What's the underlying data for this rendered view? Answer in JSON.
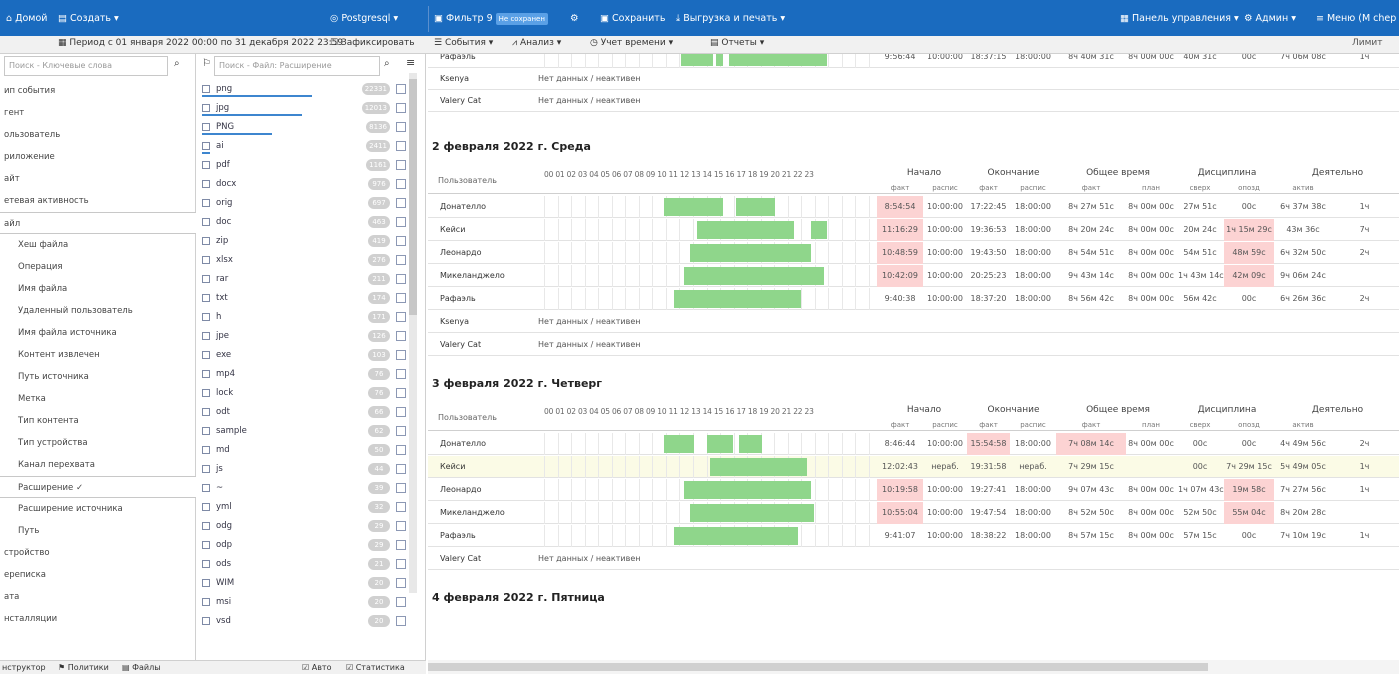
{
  "topbar": {
    "home": "Домой",
    "create": "Создать",
    "db": "Postgresql",
    "filter": "Фильтр 9",
    "not_saved": "Не сохранен",
    "save": "Сохранить",
    "export": "Выгрузка и печать",
    "dashboard": "Панель управления",
    "admin": "Админ",
    "menu": "Меню (M chep"
  },
  "toolbar": {
    "period": "Период с 01 января 2022 00:00 по 31 декабря 2022 23:59",
    "fix": "Зафиксировать",
    "events": "События",
    "analysis": "Анализ",
    "time": "Учет времени",
    "reports": "Отчеты",
    "limit": "Лимит"
  },
  "left": {
    "search": "Поиск - Ключевые слова",
    "items": [
      {
        "label": "ип события",
        "sub": false,
        "sel": false
      },
      {
        "label": "гент",
        "sub": false,
        "sel": false
      },
      {
        "label": "ользователь",
        "sub": false,
        "sel": false
      },
      {
        "label": "риложение",
        "sub": false,
        "sel": false
      },
      {
        "label": "айт",
        "sub": false,
        "sel": false
      },
      {
        "label": "етевая активность",
        "sub": false,
        "sel": false
      },
      {
        "label": "айл",
        "sub": false,
        "sel": true
      },
      {
        "label": "Хеш файла",
        "sub": true,
        "sel": false
      },
      {
        "label": "Операция",
        "sub": true,
        "sel": false
      },
      {
        "label": "Имя файла",
        "sub": true,
        "sel": false
      },
      {
        "label": "Удаленный пользователь",
        "sub": true,
        "sel": false
      },
      {
        "label": "Имя файла источника",
        "sub": true,
        "sel": false
      },
      {
        "label": "Контент извлечен",
        "sub": true,
        "sel": false
      },
      {
        "label": "Путь источника",
        "sub": true,
        "sel": false
      },
      {
        "label": "Метка",
        "sub": true,
        "sel": false
      },
      {
        "label": "Тип контента",
        "sub": true,
        "sel": false
      },
      {
        "label": "Тип устройства",
        "sub": true,
        "sel": false
      },
      {
        "label": "Канал перехвата",
        "sub": true,
        "sel": false
      },
      {
        "label": "Расширение ✓",
        "sub": true,
        "sel": true
      },
      {
        "label": "Расширение источника",
        "sub": true,
        "sel": false
      },
      {
        "label": "Путь",
        "sub": true,
        "sel": false
      },
      {
        "label": "стройство",
        "sub": false,
        "sel": false
      },
      {
        "label": "ереписка",
        "sub": false,
        "sel": false
      },
      {
        "label": "ата",
        "sub": false,
        "sel": false
      },
      {
        "label": "нсталляции",
        "sub": false,
        "sel": false
      }
    ]
  },
  "mid": {
    "search": "Поиск - Файл: Расширение",
    "exts": [
      {
        "name": "png",
        "count": "22331",
        "bar": 0.55
      },
      {
        "name": "jpg",
        "count": "12013",
        "bar": 0.5
      },
      {
        "name": "PNG",
        "count": "8136",
        "bar": 0.35
      },
      {
        "name": "ai",
        "count": "2411",
        "bar": 0.04
      },
      {
        "name": "pdf",
        "count": "1161",
        "bar": 0
      },
      {
        "name": "docx",
        "count": "976",
        "bar": 0
      },
      {
        "name": "orig",
        "count": "697",
        "bar": 0
      },
      {
        "name": "doc",
        "count": "463",
        "bar": 0
      },
      {
        "name": "zip",
        "count": "419",
        "bar": 0
      },
      {
        "name": "xlsx",
        "count": "276",
        "bar": 0
      },
      {
        "name": "rar",
        "count": "211",
        "bar": 0
      },
      {
        "name": "txt",
        "count": "174",
        "bar": 0
      },
      {
        "name": "h",
        "count": "171",
        "bar": 0
      },
      {
        "name": "jpe",
        "count": "126",
        "bar": 0
      },
      {
        "name": "exe",
        "count": "103",
        "bar": 0
      },
      {
        "name": "mp4",
        "count": "76",
        "bar": 0
      },
      {
        "name": "lock",
        "count": "76",
        "bar": 0
      },
      {
        "name": "odt",
        "count": "66",
        "bar": 0
      },
      {
        "name": "sample",
        "count": "62",
        "bar": 0
      },
      {
        "name": "md",
        "count": "50",
        "bar": 0
      },
      {
        "name": "js",
        "count": "44",
        "bar": 0
      },
      {
        "name": "~",
        "count": "39",
        "bar": 0
      },
      {
        "name": "yml",
        "count": "32",
        "bar": 0
      },
      {
        "name": "odg",
        "count": "29",
        "bar": 0
      },
      {
        "name": "odp",
        "count": "29",
        "bar": 0
      },
      {
        "name": "ods",
        "count": "21",
        "bar": 0
      },
      {
        "name": "WIM",
        "count": "20",
        "bar": 0
      },
      {
        "name": "msi",
        "count": "20",
        "bar": 0
      },
      {
        "name": "vsd",
        "count": "20",
        "bar": 0
      }
    ]
  },
  "status": {
    "constructor": "нструктор",
    "policies": "Политики",
    "files": "Файлы",
    "auto": "Авто",
    "stats": "Статистика"
  },
  "hdr": {
    "users": "Пользователь",
    "hours": "00 01 02 03 04 05 06 07 08 09 10 11 12 13 14 15 16 17 18 19 20 21 22 23",
    "start": "Начало",
    "end": "Окончание",
    "total": "Общее время",
    "disc": "Дисциплина",
    "activity": "Деятельно",
    "fact": "факт",
    "sched": "распис",
    "actual": "факт",
    "plan": "план",
    "over": "сверх",
    "late": "опозд",
    "active": "актив"
  },
  "nodata": "Нет данных / неактивен",
  "top_rows": [
    {
      "user": "Рафаэль",
      "v": [
        "9:56:44",
        "10:00:00",
        "18:37:15",
        "18:00:00",
        "8ч 40м 31с",
        "8ч 00м 00с",
        "40м 31с",
        "00с",
        "7ч 06м 08с",
        "1ч"
      ],
      "tl": [
        [
          0.42,
          0.1
        ],
        [
          0.53,
          0.02
        ],
        [
          0.57,
          0.3
        ]
      ]
    },
    {
      "user": "Ksenya",
      "nd": true
    },
    {
      "user": "Valery Cat",
      "nd": true
    }
  ],
  "days": [
    {
      "title": "2 февраля 2022 г. Среда",
      "rows": [
        {
          "user": "Донателло",
          "v": [
            "8:54:54",
            "10:00:00",
            "17:22:45",
            "18:00:00",
            "8ч 27м 51с",
            "8ч 00м 00с",
            "27м 51с",
            "00с",
            "6ч 37м 38с",
            "1ч"
          ],
          "red": [
            0,
            -1,
            -1,
            -1,
            -1,
            -1,
            -1,
            -1
          ],
          "tl": [
            [
              0.37,
              0.18
            ],
            [
              0.59,
              0.12
            ]
          ]
        },
        {
          "user": "Кейси",
          "v": [
            "11:16:29",
            "10:00:00",
            "19:36:53",
            "18:00:00",
            "8ч 20м 24с",
            "8ч 00м 00с",
            "20м 24с",
            "1ч 15м 29с",
            "43м 36с",
            "7ч"
          ],
          "red": [
            0,
            -1,
            -1,
            -1,
            -1,
            -1,
            -1,
            7
          ],
          "tl": [
            [
              0.47,
              0.3
            ],
            [
              0.82,
              0.05
            ]
          ]
        },
        {
          "user": "Леонардо",
          "v": [
            "10:48:59",
            "10:00:00",
            "19:43:50",
            "18:00:00",
            "8ч 54м 51с",
            "8ч 00м 00с",
            "54м 51с",
            "48м 59с",
            "6ч 32м 50с",
            "2ч"
          ],
          "red": [
            0,
            -1,
            -1,
            -1,
            -1,
            -1,
            -1,
            7
          ],
          "tl": [
            [
              0.45,
              0.37
            ]
          ]
        },
        {
          "user": "Микеланджело",
          "v": [
            "10:42:09",
            "10:00:00",
            "20:25:23",
            "18:00:00",
            "9ч 43м 14с",
            "8ч 00м 00с",
            "1ч 43м 14с",
            "42м 09с",
            "9ч 06м 24с",
            ""
          ],
          "red": [
            0,
            -1,
            -1,
            -1,
            -1,
            -1,
            -1,
            7
          ],
          "tl": [
            [
              0.43,
              0.43
            ]
          ]
        },
        {
          "user": "Рафаэль",
          "v": [
            "9:40:38",
            "10:00:00",
            "18:37:20",
            "18:00:00",
            "8ч 56м 42с",
            "8ч 00м 00с",
            "56м 42с",
            "00с",
            "6ч 26м 36с",
            "2ч"
          ],
          "red": [
            -1,
            -1,
            -1,
            -1,
            -1,
            -1,
            -1,
            -1
          ],
          "tl": [
            [
              0.4,
              0.39
            ]
          ]
        },
        {
          "user": "Ksenya",
          "nd": true
        },
        {
          "user": "Valery Cat",
          "nd": true
        }
      ]
    },
    {
      "title": "3 февраля 2022 г. Четверг",
      "rows": [
        {
          "user": "Донателло",
          "v": [
            "8:46:44",
            "10:00:00",
            "15:54:58",
            "18:00:00",
            "7ч 08м 14с",
            "8ч 00м 00с",
            "00с",
            "00с",
            "4ч 49м 56с",
            "2ч"
          ],
          "red": [
            -1,
            -1,
            2,
            -1,
            4,
            -1,
            -1,
            -1
          ],
          "tl": [
            [
              0.37,
              0.09
            ],
            [
              0.5,
              0.08
            ],
            [
              0.6,
              0.07
            ]
          ]
        },
        {
          "user": "Кейси",
          "v": [
            "12:02:43",
            "нераб.",
            "19:31:58",
            "нераб.",
            "7ч 29м 15с",
            "",
            "00с",
            "7ч 29м 15с",
            "5ч 49м 05с",
            "1ч"
          ],
          "yel": true,
          "tl": [
            [
              0.51,
              0.3
            ]
          ]
        },
        {
          "user": "Леонардо",
          "v": [
            "10:19:58",
            "10:00:00",
            "19:27:41",
            "18:00:00",
            "9ч 07м 43с",
            "8ч 00м 00с",
            "1ч 07м 43с",
            "19м 58с",
            "7ч 27м 56с",
            "1ч"
          ],
          "red": [
            0,
            -1,
            -1,
            -1,
            -1,
            -1,
            -1,
            7
          ],
          "tl": [
            [
              0.43,
              0.39
            ]
          ]
        },
        {
          "user": "Микеланджело",
          "v": [
            "10:55:04",
            "10:00:00",
            "19:47:54",
            "18:00:00",
            "8ч 52м 50с",
            "8ч 00м 00с",
            "52м 50с",
            "55м 04с",
            "8ч 20м 28с",
            ""
          ],
          "red": [
            0,
            -1,
            -1,
            -1,
            -1,
            -1,
            -1,
            7
          ],
          "tl": [
            [
              0.45,
              0.38
            ]
          ]
        },
        {
          "user": "Рафаэль",
          "v": [
            "9:41:07",
            "10:00:00",
            "18:38:22",
            "18:00:00",
            "8ч 57м 15с",
            "8ч 00м 00с",
            "57м 15с",
            "00с",
            "7ч 10м 19с",
            "1ч"
          ],
          "red": [
            -1,
            -1,
            -1,
            -1,
            -1,
            -1,
            -1,
            -1
          ],
          "tl": [
            [
              0.4,
              0.38
            ]
          ]
        },
        {
          "user": "Valery Cat",
          "nd": true
        }
      ]
    },
    {
      "title": "4 февраля 2022 г. Пятница",
      "rows": []
    }
  ]
}
